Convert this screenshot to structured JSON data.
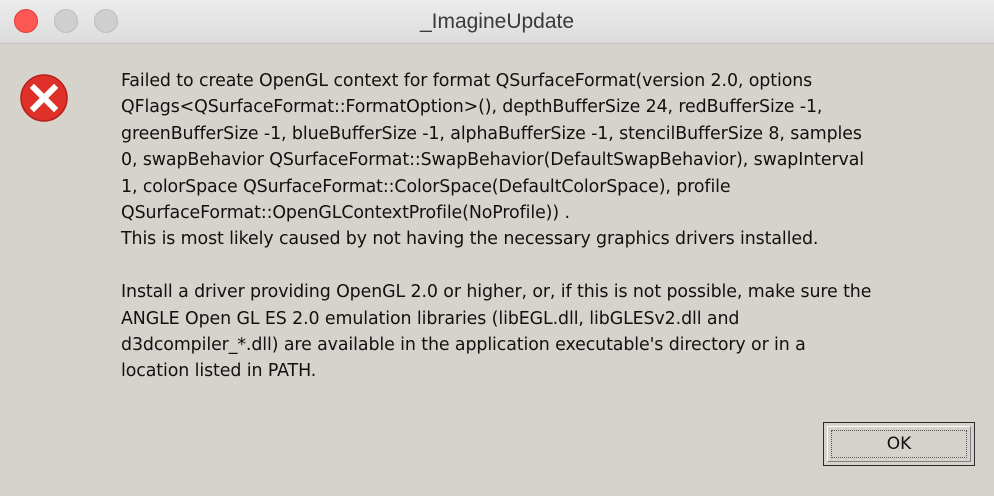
{
  "window": {
    "title": "_ImagineUpdate"
  },
  "dialog": {
    "icon": "error-icon",
    "message_lines": [
      "Failed to create OpenGL context for format QSurfaceFormat(version 2.0, options",
      "QFlags<QSurfaceFormat::FormatOption>(), depthBufferSize 24, redBufferSize -1,",
      "greenBufferSize -1, blueBufferSize -1, alphaBufferSize -1, stencilBufferSize 8, samples",
      "0, swapBehavior QSurfaceFormat::SwapBehavior(DefaultSwapBehavior), swapInterval",
      "1, colorSpace QSurfaceFormat::ColorSpace(DefaultColorSpace), profile",
      "QSurfaceFormat::OpenGLContextProfile(NoProfile)) .",
      "This is most likely caused by not having the necessary graphics drivers installed.",
      "",
      "Install a driver providing OpenGL 2.0 or higher, or, if this is not possible, make sure the",
      "ANGLE Open GL ES 2.0 emulation libraries (libEGL.dll, libGLESv2.dll and",
      "d3dcompiler_*.dll) are available in the application executable's directory or in a",
      "location listed in PATH."
    ],
    "ok_label": "OK"
  },
  "colors": {
    "error_red": "#e0302a",
    "close_button": "#fc5753"
  }
}
